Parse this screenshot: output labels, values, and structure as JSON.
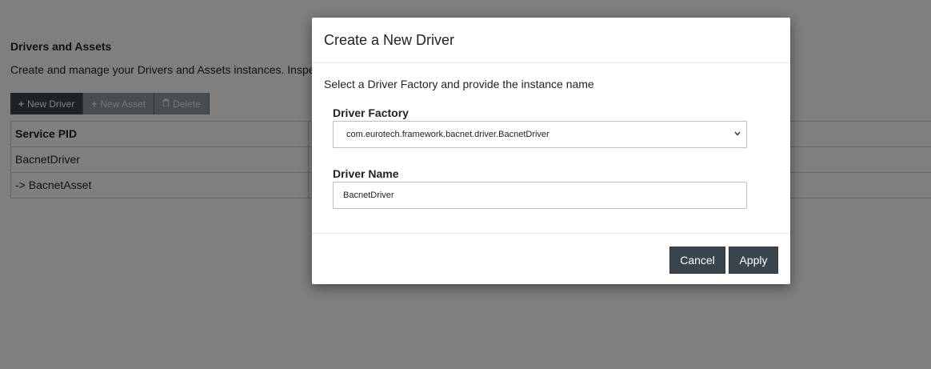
{
  "page": {
    "section_title": "Drivers and Assets",
    "section_description": "Create and manage your Drivers and Assets instances. Inspe"
  },
  "toolbar": {
    "new_driver_label": "New Driver",
    "new_asset_label": "New Asset",
    "delete_label": "Delete",
    "icons": [
      "plus-icon",
      "plus-icon",
      "trash-icon"
    ]
  },
  "table": {
    "header": "Service PID",
    "rows": [
      {
        "service_pid": "BacnetDriver"
      },
      {
        "service_pid": "-> BacnetAsset"
      }
    ]
  },
  "modal": {
    "title": "Create a New Driver",
    "intro": "Select a Driver Factory and provide the instance name",
    "factory_label": "Driver Factory",
    "factory_selected": "com.eurotech.framework.bacnet.driver.BacnetDriver",
    "name_label": "Driver Name",
    "name_value": "BacnetDriver",
    "cancel_label": "Cancel",
    "apply_label": "Apply"
  },
  "colors": {
    "primary_button": "#39454c",
    "disabled_button": "#8f9ba2",
    "overlay": "rgba(0,0,0,0.5)"
  }
}
